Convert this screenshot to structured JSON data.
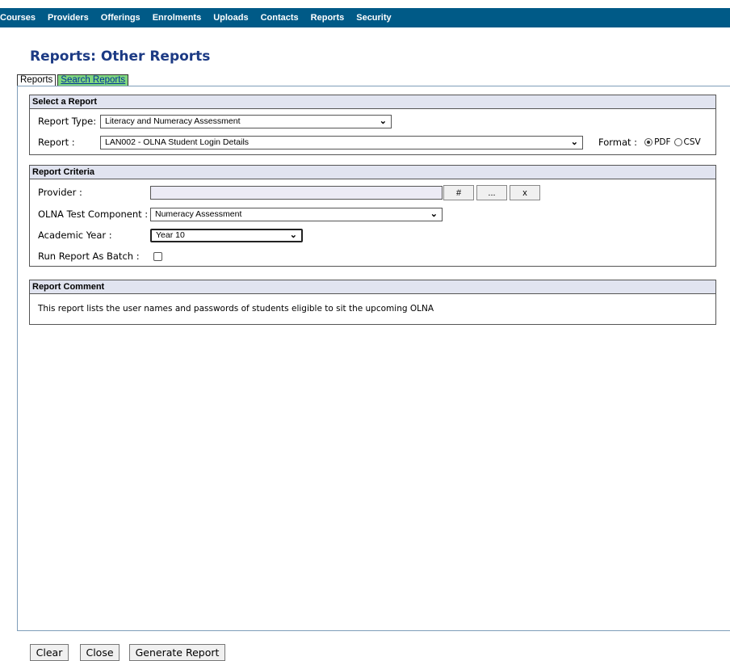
{
  "nav": {
    "items": [
      "Courses",
      "Providers",
      "Offerings",
      "Enrolments",
      "Uploads",
      "Contacts",
      "Reports",
      "Security"
    ]
  },
  "page": {
    "title": "Reports: Other Reports"
  },
  "tabs": {
    "reports": "Reports",
    "search": "Search Reports"
  },
  "select_report": {
    "header": "Select a Report",
    "report_type_label": "Report Type:",
    "report_type_value": "Literacy and Numeracy Assessment",
    "report_label": "Report :",
    "report_value": "LAN002 - OLNA Student Login Details",
    "format_label": "Format :",
    "format_pdf": "PDF",
    "format_csv": "CSV",
    "format_selected": "PDF"
  },
  "criteria": {
    "header": "Report Criteria",
    "provider_label": "Provider :",
    "provider_value": "",
    "hash_button": "#",
    "browse_button": "...",
    "clear_button": "x",
    "component_label": "OLNA Test Component :",
    "component_value": "Numeracy Assessment",
    "year_label": "Academic Year :",
    "year_value": "Year 10",
    "batch_label": "Run Report As Batch :",
    "batch_checked": false
  },
  "comment": {
    "header": "Report Comment",
    "text": "This report lists the user names and passwords of students eligible to sit the upcoming OLNA"
  },
  "actions": {
    "clear": "Clear",
    "close": "Close",
    "generate": "Generate Report"
  },
  "colors": {
    "nav_bg": "#005a87",
    "title": "#1c3a84",
    "section_header_bg": "#e1e4f0",
    "search_tab_bg": "#7fd67f"
  },
  "icons": {
    "select_chevron": "chevron-down-icon"
  }
}
